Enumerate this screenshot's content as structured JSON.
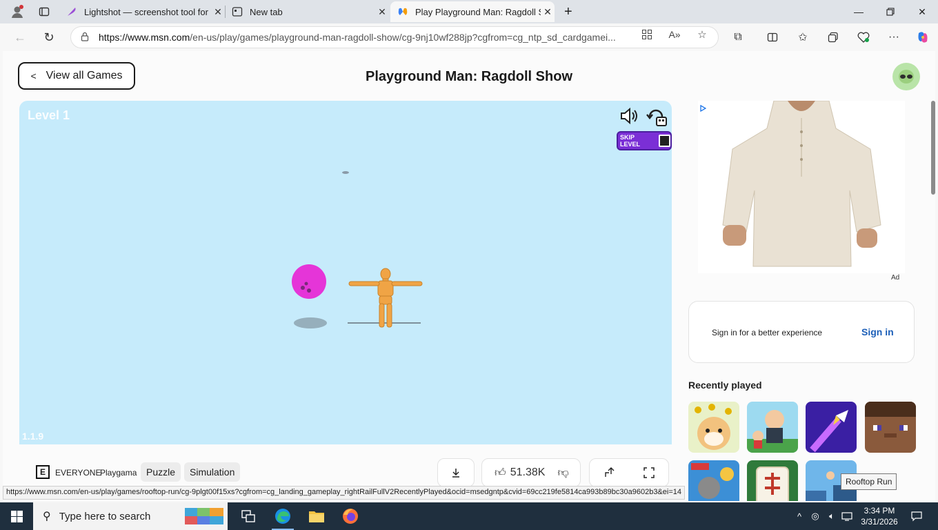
{
  "browser": {
    "tabs": [
      {
        "title": "Lightshot — screenshot tool for Mac & Win",
        "icon": "feather-icon"
      },
      {
        "title": "New tab",
        "icon": "new-tab-icon"
      },
      {
        "title": "Play Playground Man: Ragdoll Show",
        "icon": "msn-games-icon"
      }
    ],
    "url_host": "https://www.msn.com",
    "url_path": "/en-us/play/games/playground-man-ragdoll-show/cg-9nj10wf288jp?cgfrom=cg_ntp_sd_cardgamei...",
    "new_tab_glyph": "+"
  },
  "page": {
    "back_label": "View all Games",
    "title": "Playground Man: Ragdoll Show"
  },
  "game": {
    "level_text": "Level 1",
    "version_text": "1.1.9",
    "skip_label": "SKIP LEVEL",
    "ball_color": "#e535d8",
    "sky_color": "#c6ebfb"
  },
  "game_info": {
    "esrb_letter": "E",
    "rating": "EVERYONE",
    "publisher": "Playgama",
    "tags": [
      "Puzzle",
      "Simulation"
    ],
    "likes": "51.38K"
  },
  "right_rail": {
    "ad_label": "Ad",
    "signin_text": "Sign in for a better experience",
    "signin_link": "Sign in",
    "recently_played_heading": "Recently played"
  },
  "status": {
    "link_preview": "https://www.msn.com/en-us/play/games/rooftop-run/cg-9plgt00f15xs?cgfrom=cg_landing_gameplay_rightRailFullV2RecentlyPlayed&ocid=msedgntp&cvid=69cc219fe5814ca993b89bc30a9602b3&ei=14",
    "tooltip": "Rooftop Run"
  },
  "taskbar": {
    "search_placeholder": "Type here to search",
    "time": "3:34 PM",
    "date": "3/31/2026"
  }
}
